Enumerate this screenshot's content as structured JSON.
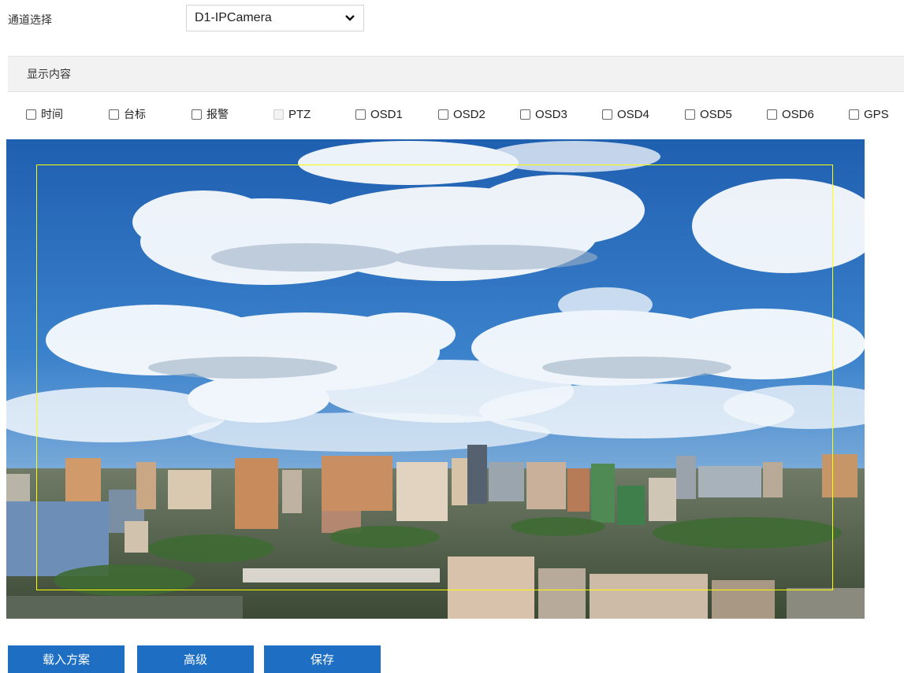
{
  "channel": {
    "label": "通道选择",
    "selected": "D1-IPCamera"
  },
  "display_section": {
    "title": "显示内容"
  },
  "display_options": [
    {
      "label": "时间",
      "checked": false,
      "disabled": false
    },
    {
      "label": "台标",
      "checked": false,
      "disabled": false
    },
    {
      "label": "报警",
      "checked": false,
      "disabled": false
    },
    {
      "label": "PTZ",
      "checked": false,
      "disabled": true
    },
    {
      "label": "OSD1",
      "checked": false,
      "disabled": false
    },
    {
      "label": "OSD2",
      "checked": false,
      "disabled": false
    },
    {
      "label": "OSD3",
      "checked": false,
      "disabled": false
    },
    {
      "label": "OSD4",
      "checked": false,
      "disabled": false
    },
    {
      "label": "OSD5",
      "checked": false,
      "disabled": false
    },
    {
      "label": "OSD6",
      "checked": false,
      "disabled": false
    },
    {
      "label": "GPS",
      "checked": false,
      "disabled": false
    }
  ],
  "buttons": {
    "load_plan": "载入方案",
    "advanced": "高级",
    "save": "保存"
  },
  "colors": {
    "button_bg": "#1e6fc3",
    "osd_region_border": "#ffff00",
    "section_bg": "#f2f2f2"
  }
}
